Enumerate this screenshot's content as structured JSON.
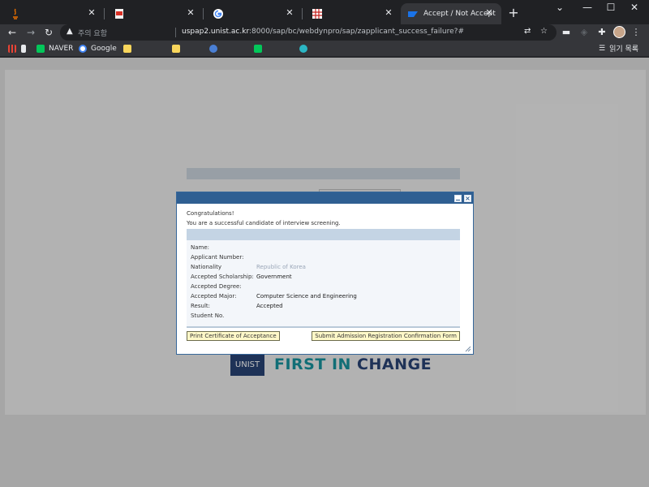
{
  "browser": {
    "tabs": [
      {
        "title": "",
        "icon": "java-icon"
      },
      {
        "title": "",
        "icon": "pdf-icon"
      },
      {
        "title": "",
        "icon": "google-icon"
      },
      {
        "title": "",
        "icon": "grid-app-icon"
      },
      {
        "title": "Accept / Not Accept",
        "icon": "sap-icon",
        "active": true
      }
    ],
    "new_tab_label": "+",
    "window_controls": {
      "menu": "⌄",
      "minimize": "—",
      "maximize": "☐",
      "close": "✕"
    },
    "address": {
      "security_text": "주의 요함",
      "host": "uspap2.unist.ac.kr",
      "rest": ":8000/sap/bc/webdynpro/sap/zapplicant_success_failure?#"
    },
    "bookmarks": [
      {
        "label": "",
        "icon": "apps-icon"
      },
      {
        "label": "",
        "icon": "bookmark-icon"
      },
      {
        "label": "NAVER",
        "icon": "naver-icon"
      },
      {
        "label": "Google",
        "icon": "google-icon"
      },
      {
        "label": "",
        "icon": "folder-icon"
      },
      {
        "label": "",
        "icon": "folder-icon"
      },
      {
        "label": "",
        "icon": "site-icon"
      },
      {
        "label": "",
        "icon": "naver-icon"
      },
      {
        "label": "",
        "icon": "edge-icon"
      }
    ],
    "reading_list": "읽기 목록"
  },
  "page": {
    "logo_text": "UNIST",
    "slogan_part1": "FIRST IN",
    "slogan_part2": "CHANGE"
  },
  "dialog": {
    "message_line1": "Congratulations!",
    "message_line2": "You are a successful candidate of interview screening.",
    "fields": [
      {
        "label": "Name:",
        "value": ""
      },
      {
        "label": "Applicant Number:",
        "value": ""
      },
      {
        "label": "Nationality",
        "value": "Republic of Korea"
      },
      {
        "label": "Accepted Scholarship:",
        "value": "Government"
      },
      {
        "label": "Accepted Degree:",
        "value": ""
      },
      {
        "label": "Accepted Major:",
        "value": "Computer Science and Engineering"
      },
      {
        "label": "Result:",
        "value": "Accepted"
      },
      {
        "label": "Student No.",
        "value": ""
      }
    ],
    "buttons": {
      "print": "Print Certificate of Acceptance",
      "submit": "Submit Admission Registration Confirmation Form"
    }
  }
}
